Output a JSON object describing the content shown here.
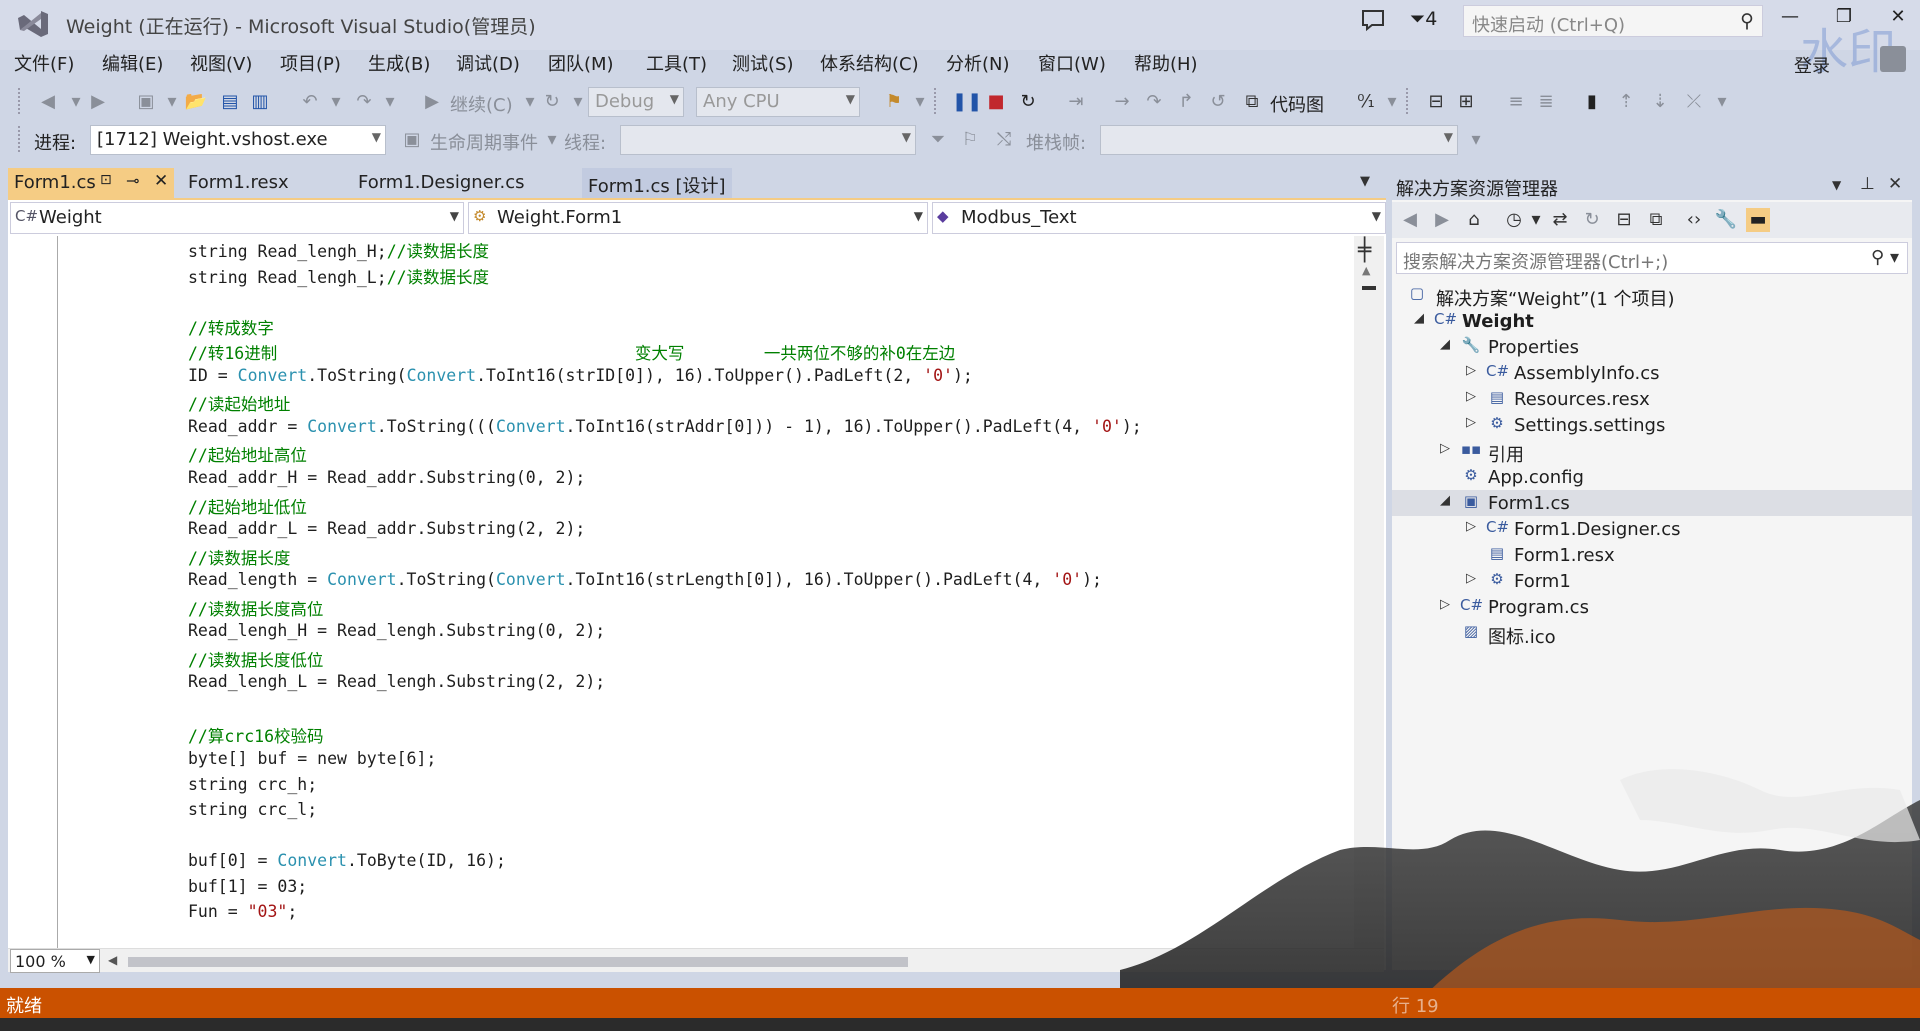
{
  "window": {
    "title": "Weight (正在运行) - Microsoft Visual Studio(管理员)",
    "filter_count": "4",
    "quick_launch_placeholder": "快速启动 (Ctrl+Q)",
    "login": "登录",
    "watermark": "水印"
  },
  "menu": [
    "文件(F)",
    "编辑(E)",
    "视图(V)",
    "项目(P)",
    "生成(B)",
    "调试(D)",
    "团队(M)",
    "工具(T)",
    "测试(S)",
    "体系结构(C)",
    "分析(N)",
    "窗口(W)",
    "帮助(H)"
  ],
  "toolbar": {
    "continue_label": "继续(C)",
    "config": "Debug",
    "platform": "Any CPU",
    "code_map_label": "代码图",
    "process_label": "进程:",
    "process_value": "[1712] Weight.vshost.exe",
    "lifecycle_label": "生命周期事件",
    "thread_label": "线程:",
    "stack_label": "堆栈帧:"
  },
  "editor": {
    "tabs": [
      "Form1.cs",
      "Form1.resx",
      "Form1.Designer.cs",
      "Form1.cs [设计]"
    ],
    "tab_pin": "⊸",
    "nav_project": "Weight",
    "nav_class": "Weight.Form1",
    "nav_member": "Modbus_Text",
    "zoom": "100 %"
  },
  "code_lines": [
    {
      "parts": [
        [
          "kw",
          "string Read_lengh_H;"
        ],
        [
          "cm",
          "//读数据长度"
        ]
      ]
    },
    {
      "parts": [
        [
          "kw",
          "string Read_lengh_L;"
        ],
        [
          "cm",
          "//读数据长度"
        ]
      ]
    },
    {
      "parts": []
    },
    {
      "parts": [
        [
          "cm",
          "//转成数字"
        ]
      ]
    },
    {
      "parts": [
        [
          "cm",
          "//转16进制                                    变大写        一共两位不够的补0在左边"
        ]
      ]
    },
    {
      "parts": [
        [
          "kw",
          "ID = "
        ],
        [
          "ty",
          "Convert"
        ],
        [
          "kw",
          ".ToString("
        ],
        [
          "ty",
          "Convert"
        ],
        [
          "kw",
          ".ToInt16(strID[0]), 16).ToUpper().PadLeft(2, "
        ],
        [
          "st",
          "'0'"
        ],
        [
          "kw",
          ");"
        ]
      ]
    },
    {
      "parts": [
        [
          "cm",
          "//读起始地址"
        ]
      ]
    },
    {
      "parts": [
        [
          "kw",
          "Read_addr = "
        ],
        [
          "ty",
          "Convert"
        ],
        [
          "kw",
          ".ToString((("
        ],
        [
          "ty",
          "Convert"
        ],
        [
          "kw",
          ".ToInt16(strAddr[0])) - 1), 16).ToUpper().PadLeft(4, "
        ],
        [
          "st",
          "'0'"
        ],
        [
          "kw",
          ");"
        ]
      ]
    },
    {
      "parts": [
        [
          "cm",
          "//起始地址高位"
        ]
      ]
    },
    {
      "parts": [
        [
          "kw",
          "Read_addr_H = Read_addr.Substring(0, 2);"
        ]
      ]
    },
    {
      "parts": [
        [
          "cm",
          "//起始地址低位"
        ]
      ]
    },
    {
      "parts": [
        [
          "kw",
          "Read_addr_L = Read_addr.Substring(2, 2);"
        ]
      ]
    },
    {
      "parts": [
        [
          "cm",
          "//读数据长度"
        ]
      ]
    },
    {
      "parts": [
        [
          "kw",
          "Read_length = "
        ],
        [
          "ty",
          "Convert"
        ],
        [
          "kw",
          ".ToString("
        ],
        [
          "ty",
          "Convert"
        ],
        [
          "kw",
          ".ToInt16(strLength[0]), 16).ToUpper().PadLeft(4, "
        ],
        [
          "st",
          "'0'"
        ],
        [
          "kw",
          ");"
        ]
      ]
    },
    {
      "parts": [
        [
          "cm",
          "//读数据长度高位"
        ]
      ]
    },
    {
      "parts": [
        [
          "kw",
          "Read_lengh_H = Read_lengh.Substring(0, 2);"
        ]
      ]
    },
    {
      "parts": [
        [
          "cm",
          "//读数据长度低位"
        ]
      ]
    },
    {
      "parts": [
        [
          "kw",
          "Read_lengh_L = Read_lengh.Substring(2, 2);"
        ]
      ]
    },
    {
      "parts": []
    },
    {
      "parts": [
        [
          "cm",
          "//算crc16校验码"
        ]
      ]
    },
    {
      "parts": [
        [
          "kw",
          "byte[] buf = new byte[6];"
        ]
      ]
    },
    {
      "parts": [
        [
          "kw",
          "string crc_h;"
        ]
      ]
    },
    {
      "parts": [
        [
          "kw",
          "string crc_l;"
        ]
      ]
    },
    {
      "parts": []
    },
    {
      "parts": [
        [
          "kw",
          "buf[0] = "
        ],
        [
          "ty",
          "Convert"
        ],
        [
          "kw",
          ".ToByte(ID, 16);"
        ]
      ]
    },
    {
      "parts": [
        [
          "kw",
          "buf[1] = 03;"
        ]
      ]
    },
    {
      "parts": [
        [
          "kw",
          "Fun = "
        ],
        [
          "st",
          "\"03\""
        ],
        [
          "kw",
          ";"
        ]
      ]
    }
  ],
  "solution_explorer": {
    "title": "解决方案资源管理器",
    "search_placeholder": "搜索解决方案资源管理器(Ctrl+;)",
    "items": [
      {
        "label": "解决方案“Weight”(1 个项目)",
        "icon": "solution-icon",
        "level": 0,
        "expander": "",
        "bold": false
      },
      {
        "label": "Weight",
        "icon": "csharp-project-icon",
        "level": 0,
        "expander": "◢",
        "bold": true
      },
      {
        "label": "Properties",
        "icon": "wrench-icon",
        "level": 1,
        "expander": "◢",
        "bold": false
      },
      {
        "label": "AssemblyInfo.cs",
        "icon": "csharp-file-icon",
        "level": 2,
        "expander": "▷",
        "bold": false
      },
      {
        "label": "Resources.resx",
        "icon": "resource-file-icon",
        "level": 2,
        "expander": "▷",
        "bold": false
      },
      {
        "label": "Settings.settings",
        "icon": "gear-icon",
        "level": 2,
        "expander": "▷",
        "bold": false
      },
      {
        "label": "引用",
        "icon": "references-icon",
        "level": 1,
        "expander": "▷",
        "bold": false
      },
      {
        "label": "App.config",
        "icon": "config-file-icon",
        "level": 1,
        "expander": "",
        "bold": false
      },
      {
        "label": "Form1.cs",
        "icon": "form-icon",
        "level": 1,
        "expander": "◢",
        "bold": false,
        "selected": true
      },
      {
        "label": "Form1.Designer.cs",
        "icon": "csharp-file-icon",
        "level": 2,
        "expander": "▷",
        "bold": false
      },
      {
        "label": "Form1.resx",
        "icon": "resource-file-icon",
        "level": 2,
        "expander": "",
        "bold": false
      },
      {
        "label": "Form1",
        "icon": "class-icon",
        "level": 2,
        "expander": "▷",
        "bold": false
      },
      {
        "label": "Program.cs",
        "icon": "csharp-file-icon",
        "level": 1,
        "expander": "▷",
        "bold": false
      },
      {
        "label": "图标.ico",
        "icon": "icon-file-icon",
        "level": 1,
        "expander": "",
        "bold": false
      }
    ]
  },
  "status": {
    "text": "就绪",
    "line": "行 19"
  },
  "colors": {
    "status_bar": "#ca5100",
    "active_tab": "#f5cc84",
    "comment": "#008000",
    "type": "#2b91af",
    "string": "#a31515"
  }
}
